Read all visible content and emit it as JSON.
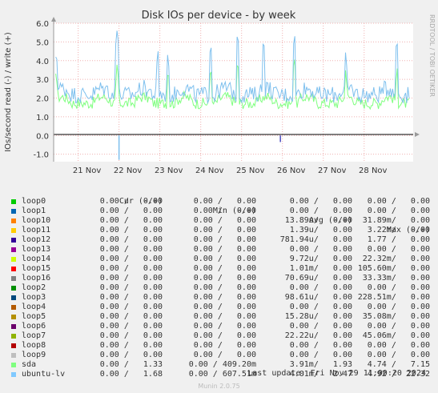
{
  "chart_data": {
    "type": "line",
    "title": "Disk IOs per device - by week",
    "ylabel": "IOs/second read (-) / write (+)",
    "ylim": [
      -1.4,
      6.0
    ],
    "y_ticks": [
      "-1.0",
      "0.0",
      "1.0",
      "2.0",
      "3.0",
      "4.0",
      "5.0",
      "6.0"
    ],
    "y_tick_values": [
      -1,
      0,
      1,
      2,
      3,
      4,
      5,
      6
    ],
    "x_ticks": [
      "21 Nov",
      "22 Nov",
      "23 Nov",
      "24 Nov",
      "25 Nov",
      "26 Nov",
      "27 Nov",
      "28 Nov"
    ],
    "x_range_days": [
      20.4,
      29.2
    ],
    "x_tick_values": [
      21,
      22,
      23,
      24,
      25,
      26,
      27,
      28
    ],
    "grid": true,
    "side_label": "RRDTOOL / TOBI OETIKER",
    "series": [
      {
        "name": "ubuntu-lv",
        "color": "#7ec0ee",
        "avg_write": 2.47,
        "max_write": 22.32,
        "peaks": [
          [
            20.45,
            4.2
          ],
          [
            21.95,
            5.6
          ],
          [
            22.95,
            4.6
          ],
          [
            23.2,
            4.4
          ],
          [
            24.25,
            4.8
          ],
          [
            24.9,
            5.3
          ],
          [
            25.55,
            4.9
          ],
          [
            26.3,
            5.4
          ],
          [
            27.55,
            4.6
          ],
          [
            28.8,
            5.0
          ]
        ]
      },
      {
        "name": "sda",
        "color": "#80ff80",
        "avg_write": 1.93,
        "max_write": 7.15,
        "peaks": [
          [
            20.45,
            3.3
          ],
          [
            21.95,
            3.8
          ],
          [
            23.2,
            3.4
          ],
          [
            24.25,
            3.6
          ],
          [
            24.9,
            4.0
          ],
          [
            26.3,
            4.1
          ],
          [
            27.55,
            3.5
          ],
          [
            28.8,
            3.6
          ]
        ]
      }
    ],
    "read_dips": [
      {
        "x": 22.0,
        "y": -1.3,
        "color": "#7ec0ee"
      },
      {
        "x": 25.95,
        "y": -0.35,
        "color": "#4c4cc0"
      }
    ]
  },
  "legend": {
    "header": {
      "cur": "Cur (-/+)",
      "min": "Min (-/+)",
      "avg": "Avg (-/+)",
      "max": "Max (-/+)"
    },
    "rows": [
      {
        "name": "loop0",
        "color": "#00cc00",
        "cur": "0.00 /   0.00",
        "min": "0.00 /   0.00",
        "avg": "0.00 /   0.00",
        "max": "0.00 /   0.00"
      },
      {
        "name": "loop1",
        "color": "#0066b3",
        "cur": "0.00 /   0.00",
        "min": "0.00 /   0.00",
        "avg": "0.00 /   0.00",
        "max": "0.00 /   0.00"
      },
      {
        "name": "loop10",
        "color": "#ff8000",
        "cur": "0.00 /   0.00",
        "min": "0.00 /   0.00",
        "avg": "13.89u/   0.00",
        "max": "31.89m/   0.00"
      },
      {
        "name": "loop11",
        "color": "#ffcc00",
        "cur": "0.00 /   0.00",
        "min": "0.00 /   0.00",
        "avg": "1.39u/   0.00",
        "max": "3.22m/   0.00"
      },
      {
        "name": "loop12",
        "color": "#330099",
        "cur": "0.00 /   0.00",
        "min": "0.00 /   0.00",
        "avg": "781.94u/   0.00",
        "max": "1.77 /   0.00"
      },
      {
        "name": "loop13",
        "color": "#990099",
        "cur": "0.00 /   0.00",
        "min": "0.00 /   0.00",
        "avg": "0.00 /   0.00",
        "max": "0.00 /   0.00"
      },
      {
        "name": "loop14",
        "color": "#ccff00",
        "cur": "0.00 /   0.00",
        "min": "0.00 /   0.00",
        "avg": "9.72u/   0.00",
        "max": "22.32m/   0.00"
      },
      {
        "name": "loop15",
        "color": "#ff0000",
        "cur": "0.00 /   0.00",
        "min": "0.00 /   0.00",
        "avg": "1.01m/   0.00",
        "max": "105.60m/   0.00"
      },
      {
        "name": "loop16",
        "color": "#808080",
        "cur": "0.00 /   0.00",
        "min": "0.00 /   0.00",
        "avg": "70.69u/   0.00",
        "max": "33.33m/   0.00"
      },
      {
        "name": "loop2",
        "color": "#008f00",
        "cur": "0.00 /   0.00",
        "min": "0.00 /   0.00",
        "avg": "0.00 /   0.00",
        "max": "0.00 /   0.00"
      },
      {
        "name": "loop3",
        "color": "#00487d",
        "cur": "0.00 /   0.00",
        "min": "0.00 /   0.00",
        "avg": "98.61u/   0.00",
        "max": "228.51m/   0.00"
      },
      {
        "name": "loop4",
        "color": "#b35a00",
        "cur": "0.00 /   0.00",
        "min": "0.00 /   0.00",
        "avg": "0.00 /   0.00",
        "max": "0.00 /   0.00"
      },
      {
        "name": "loop5",
        "color": "#b38f00",
        "cur": "0.00 /   0.00",
        "min": "0.00 /   0.00",
        "avg": "15.28u/   0.00",
        "max": "35.08m/   0.00"
      },
      {
        "name": "loop6",
        "color": "#6b006b",
        "cur": "0.00 /   0.00",
        "min": "0.00 /   0.00",
        "avg": "0.00 /   0.00",
        "max": "0.00 /   0.00"
      },
      {
        "name": "loop7",
        "color": "#8fb300",
        "cur": "0.00 /   0.00",
        "min": "0.00 /   0.00",
        "avg": "22.22u/   0.00",
        "max": "45.06m/   0.00"
      },
      {
        "name": "loop8",
        "color": "#b30000",
        "cur": "0.00 /   0.00",
        "min": "0.00 /   0.00",
        "avg": "0.00 /   0.00",
        "max": "0.00 /   0.00"
      },
      {
        "name": "loop9",
        "color": "#bebebe",
        "cur": "0.00 /   0.00",
        "min": "0.00 /   0.00",
        "avg": "0.00 /   0.00",
        "max": "0.00 /   0.00"
      },
      {
        "name": "sda",
        "color": "#80ff80",
        "cur": "0.00 /   1.33",
        "min": "0.00 / 409.20m",
        "avg": "3.91m/   1.93",
        "max": "4.74 /   7.15"
      },
      {
        "name": "ubuntu-lv",
        "color": "#80c9ff",
        "cur": "0.00 /   1.68",
        "min": "0.00 / 607.51m",
        "avg": "4.01m/   2.47",
        "max": "4.92 /  22.32"
      }
    ]
  },
  "last_update": "Last update: Fri Nov 29 11:00:20 2024",
  "footer": "Munin 2.0.75"
}
